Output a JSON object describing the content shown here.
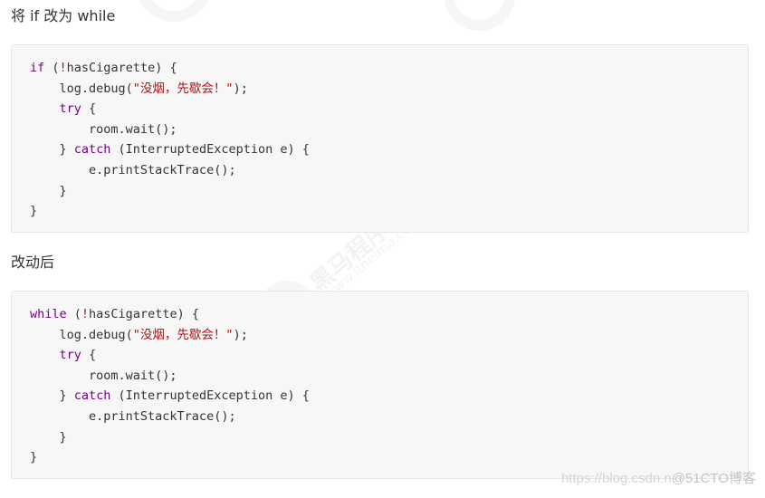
{
  "sections": [
    {
      "heading": "将 if 改为 while",
      "code": [
        [
          {
            "t": "kw",
            "v": "if"
          },
          {
            "t": "plain",
            "v": " ("
          },
          {
            "t": "bang",
            "v": "!"
          },
          {
            "t": "plain",
            "v": "hasCigarette) {"
          }
        ],
        [
          {
            "t": "plain",
            "v": "    log.debug("
          },
          {
            "t": "str",
            "v": "\"没烟，先歇会！\""
          },
          {
            "t": "plain",
            "v": ");"
          }
        ],
        [
          {
            "t": "plain",
            "v": "    "
          },
          {
            "t": "kw",
            "v": "try"
          },
          {
            "t": "plain",
            "v": " {"
          }
        ],
        [
          {
            "t": "plain",
            "v": "        room.wait();"
          }
        ],
        [
          {
            "t": "plain",
            "v": "    } "
          },
          {
            "t": "kw",
            "v": "catch"
          },
          {
            "t": "plain",
            "v": " (InterruptedException e) {"
          }
        ],
        [
          {
            "t": "plain",
            "v": "        e.printStackTrace();"
          }
        ],
        [
          {
            "t": "plain",
            "v": "    }"
          }
        ],
        [
          {
            "t": "plain",
            "v": "}"
          }
        ]
      ]
    },
    {
      "heading": "改动后",
      "code": [
        [
          {
            "t": "kw",
            "v": "while"
          },
          {
            "t": "plain",
            "v": " ("
          },
          {
            "t": "bang",
            "v": "!"
          },
          {
            "t": "plain",
            "v": "hasCigarette) {"
          }
        ],
        [
          {
            "t": "plain",
            "v": "    log.debug("
          },
          {
            "t": "str",
            "v": "\"没烟，先歇会！\""
          },
          {
            "t": "plain",
            "v": ");"
          }
        ],
        [
          {
            "t": "plain",
            "v": "    "
          },
          {
            "t": "kw",
            "v": "try"
          },
          {
            "t": "plain",
            "v": " {"
          }
        ],
        [
          {
            "t": "plain",
            "v": "        room.wait();"
          }
        ],
        [
          {
            "t": "plain",
            "v": "    } "
          },
          {
            "t": "kw",
            "v": "catch"
          },
          {
            "t": "plain",
            "v": " (InterruptedException e) {"
          }
        ],
        [
          {
            "t": "plain",
            "v": "        e.printStackTrace();"
          }
        ],
        [
          {
            "t": "plain",
            "v": "    }"
          }
        ],
        [
          {
            "t": "plain",
            "v": "}"
          }
        ]
      ]
    }
  ],
  "watermark": {
    "brand_cn": "黑马程序员",
    "site": "www.itheima.com"
  },
  "footer": {
    "url": "https://blog.csdn.n",
    "brand": "@51CTO博客"
  },
  "colors": {
    "keyword": "#770088",
    "string": "#aa1111",
    "code_bg": "#f7f7f7"
  }
}
